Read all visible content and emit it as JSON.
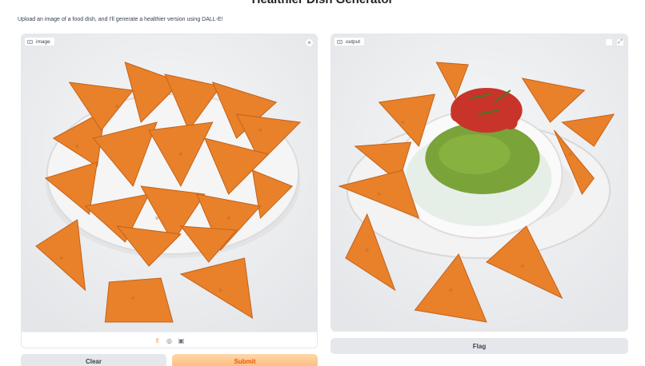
{
  "page": {
    "title": "Healthier Dish Generator",
    "description": "Upload an image of a food dish, and I'll generate a healthier version using DALL-E!"
  },
  "input_panel": {
    "label": "image",
    "close_symbol": "×",
    "image_description": "Bowl of nacho cheese tortilla chips",
    "toolbar_icons": [
      "upload-icon",
      "webcam-icon",
      "clipboard-icon"
    ]
  },
  "output_panel": {
    "label": "output",
    "image_description": "Guacamole and salsa dip with tortilla chips"
  },
  "buttons": {
    "clear": "Clear",
    "submit": "Submit",
    "flag": "Flag"
  },
  "colors": {
    "accent": "#f97316",
    "chip": "#e8812a",
    "guacamole": "#7aa33a",
    "salsa": "#c8342a"
  }
}
